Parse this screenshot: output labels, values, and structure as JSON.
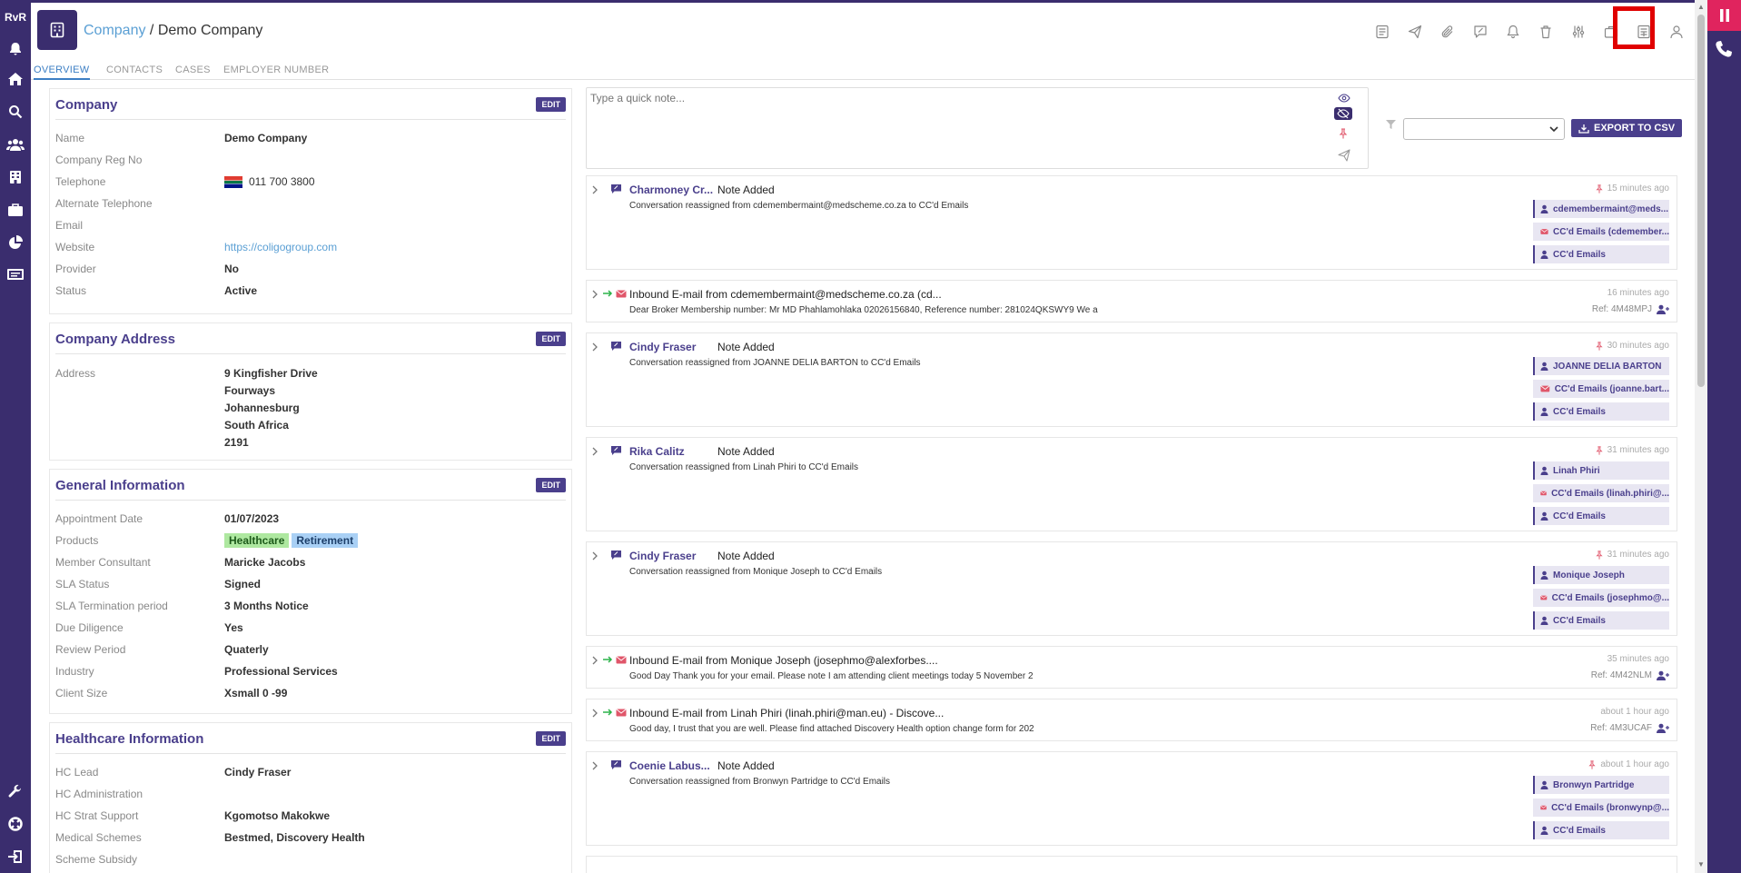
{
  "app": {
    "logo": "RvR"
  },
  "colors": {
    "brand": "#3a2d6e",
    "accent": "#4a3f8c",
    "link": "#5a9fd4",
    "highlight": "#e00000",
    "pause": "#e0245e"
  },
  "left_nav": [
    "bell-icon",
    "home-icon",
    "search-icon",
    "users-icon",
    "building-icon",
    "briefcase-icon",
    "pie-chart-icon",
    "monitor-icon",
    "wrench-icon",
    "lifebuoy-icon",
    "logout-icon"
  ],
  "header": {
    "crumb_root": "Company",
    "crumb_sep": " / ",
    "crumb_current": "Demo Company"
  },
  "tabs": [
    "OVERVIEW",
    "CONTACTS",
    "CASES",
    "EMPLOYER NUMBER"
  ],
  "edit_label": "EDIT",
  "company": {
    "title": "Company",
    "rows": [
      {
        "label": "Name",
        "value": "Demo Company"
      },
      {
        "label": "Company Reg No",
        "value": ""
      },
      {
        "label": "Telephone",
        "value": "011 700 3800"
      },
      {
        "label": "Alternate Telephone",
        "value": ""
      },
      {
        "label": "Email",
        "value": ""
      },
      {
        "label": "Website",
        "value": "https://coligogroup.com"
      },
      {
        "label": "Provider",
        "value": "No"
      },
      {
        "label": "Status",
        "value": "Active"
      }
    ]
  },
  "address": {
    "title": "Company Address",
    "label": "Address",
    "lines": [
      "9 Kingfisher Drive",
      "Fourways",
      "Johannesburg",
      "South Africa",
      "2191"
    ]
  },
  "general": {
    "title": "General Information",
    "rows": [
      {
        "label": "Appointment Date",
        "value": "01/07/2023"
      },
      {
        "label": "Products",
        "value": ""
      },
      {
        "label": "Member Consultant",
        "value": "Maricke Jacobs"
      },
      {
        "label": "SLA Status",
        "value": "Signed"
      },
      {
        "label": "SLA Termination period",
        "value": "3 Months Notice"
      },
      {
        "label": "Due Diligence",
        "value": "Yes"
      },
      {
        "label": "Review Period",
        "value": "Quaterly"
      },
      {
        "label": "Industry",
        "value": "Professional Services"
      },
      {
        "label": "Client Size",
        "value": "Xsmall 0 -99"
      }
    ],
    "products": [
      "Healthcare",
      "Retirement"
    ]
  },
  "healthcare": {
    "title": "Healthcare Information",
    "rows": [
      {
        "label": "HC Lead",
        "value": "Cindy Fraser"
      },
      {
        "label": "HC Administration",
        "value": ""
      },
      {
        "label": "HC Strat Support",
        "value": "Kgomotso Makokwe"
      },
      {
        "label": "Medical Schemes",
        "value": "Bestmed, Discovery Health"
      },
      {
        "label": "Scheme Subsidy",
        "value": ""
      }
    ]
  },
  "quick_note": {
    "placeholder": "Type a quick note..."
  },
  "export_label": "EXPORT TO CSV",
  "feed": [
    {
      "type": "note",
      "who": "Charmoney Cr...",
      "action": "Note Added",
      "body": "Conversation reassigned from cdemembermaint@medscheme.co.za to CC'd Emails",
      "time": "15 minutes ago",
      "pinned": true,
      "recipients": [
        {
          "k": "user",
          "t": "cdemembermaint@meds..."
        },
        {
          "k": "mail",
          "t": "CC'd Emails (cdemember..."
        },
        {
          "k": "user",
          "t": "CC'd Emails"
        }
      ]
    },
    {
      "type": "email",
      "subject": "Inbound E-mail from cdemembermaint@medscheme.co.za (cd...",
      "body": "Dear Broker Membership number: Mr MD Phahlamohlaka 02026156840, Reference number: 281024QKSWY9 We a",
      "time": "16 minutes ago",
      "ref": "Ref: 4M48MPJ"
    },
    {
      "type": "note",
      "who": "Cindy Fraser",
      "action": "Note Added",
      "body": "Conversation reassigned from JOANNE DELIA BARTON to CC'd Emails",
      "time": "30 minutes ago",
      "pinned": true,
      "recipients": [
        {
          "k": "user",
          "t": "JOANNE DELIA BARTON"
        },
        {
          "k": "mail",
          "t": "CC'd Emails (joanne.bart..."
        },
        {
          "k": "user",
          "t": "CC'd Emails"
        }
      ]
    },
    {
      "type": "note",
      "who": "Rika Calitz",
      "action": "Note Added",
      "body": "Conversation reassigned from Linah Phiri to CC'd Emails",
      "time": "31 minutes ago",
      "pinned": true,
      "recipients": [
        {
          "k": "user",
          "t": "Linah Phiri"
        },
        {
          "k": "mail",
          "t": "CC'd Emails (linah.phiri@..."
        },
        {
          "k": "user",
          "t": "CC'd Emails"
        }
      ]
    },
    {
      "type": "note",
      "who": "Cindy Fraser",
      "action": "Note Added",
      "body": "Conversation reassigned from Monique Joseph to CC'd Emails",
      "time": "31 minutes ago",
      "pinned": true,
      "recipients": [
        {
          "k": "user",
          "t": "Monique Joseph"
        },
        {
          "k": "mail",
          "t": "CC'd Emails (josephmo@..."
        },
        {
          "k": "user",
          "t": "CC'd Emails"
        }
      ]
    },
    {
      "type": "email",
      "subject": "Inbound E-mail from Monique Joseph (josephmo@alexforbes....",
      "body": "Good Day   Thank you for your email. Please note I am attending client meetings today 5 November 2",
      "time": "35 minutes ago",
      "ref": "Ref: 4M42NLM"
    },
    {
      "type": "email",
      "subject": "Inbound E-mail from Linah Phiri (linah.phiri@man.eu) - Discove...",
      "body": "Good day, I trust that you are well. Please find attached Discovery Health option change form for 202",
      "time": "about 1 hour ago",
      "ref": "Ref: 4M3UCAF"
    },
    {
      "type": "note",
      "who": "Coenie Labus...",
      "action": "Note Added",
      "body": "Conversation reassigned from Bronwyn Partridge to CC'd Emails",
      "time": "about 1 hour ago",
      "pinned": true,
      "recipients": [
        {
          "k": "user",
          "t": "Bronwyn Partridge"
        },
        {
          "k": "mail",
          "t": "CC'd Emails (bronwynp@..."
        },
        {
          "k": "user",
          "t": "CC'd Emails"
        }
      ]
    }
  ]
}
